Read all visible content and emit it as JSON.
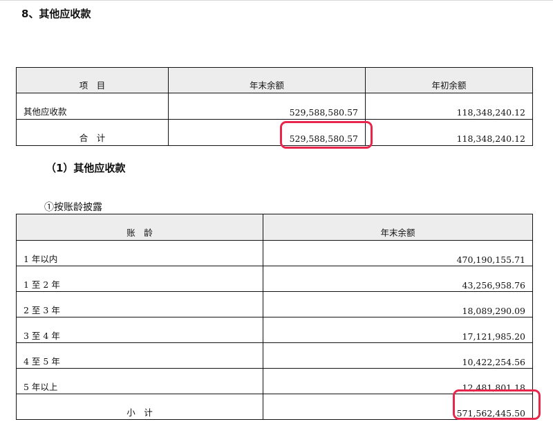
{
  "section_title": "8、其他应收款",
  "table1": {
    "headers": [
      "项　目",
      "年末余额",
      "年初余额"
    ],
    "rows": [
      {
        "label": "其他应收款",
        "end": "529,588,580.57",
        "begin": "118,348,240.12"
      },
      {
        "label": "合　计",
        "end": "529,588,580.57",
        "begin": "118,348,240.12"
      }
    ]
  },
  "subsection_title": "（1）其他应收款",
  "aging_caption": "①按账龄披露",
  "table2": {
    "headers": [
      "账　龄",
      "年末余额"
    ],
    "rows": [
      {
        "label": "1 年以内",
        "end": "470,190,155.71"
      },
      {
        "label": "1 至 2 年",
        "end": "43,256,958.76"
      },
      {
        "label": "2 至 3 年",
        "end": "18,089,290.09"
      },
      {
        "label": "3 至 4 年",
        "end": "17,121,985.20"
      },
      {
        "label": "4 至 5 年",
        "end": "10,422,254.56"
      },
      {
        "label": "5 年以上",
        "end": "12,481,801.18"
      },
      {
        "label": "小　计",
        "end": "571,562,445.50"
      }
    ]
  },
  "highlight_color": "#e8264b"
}
